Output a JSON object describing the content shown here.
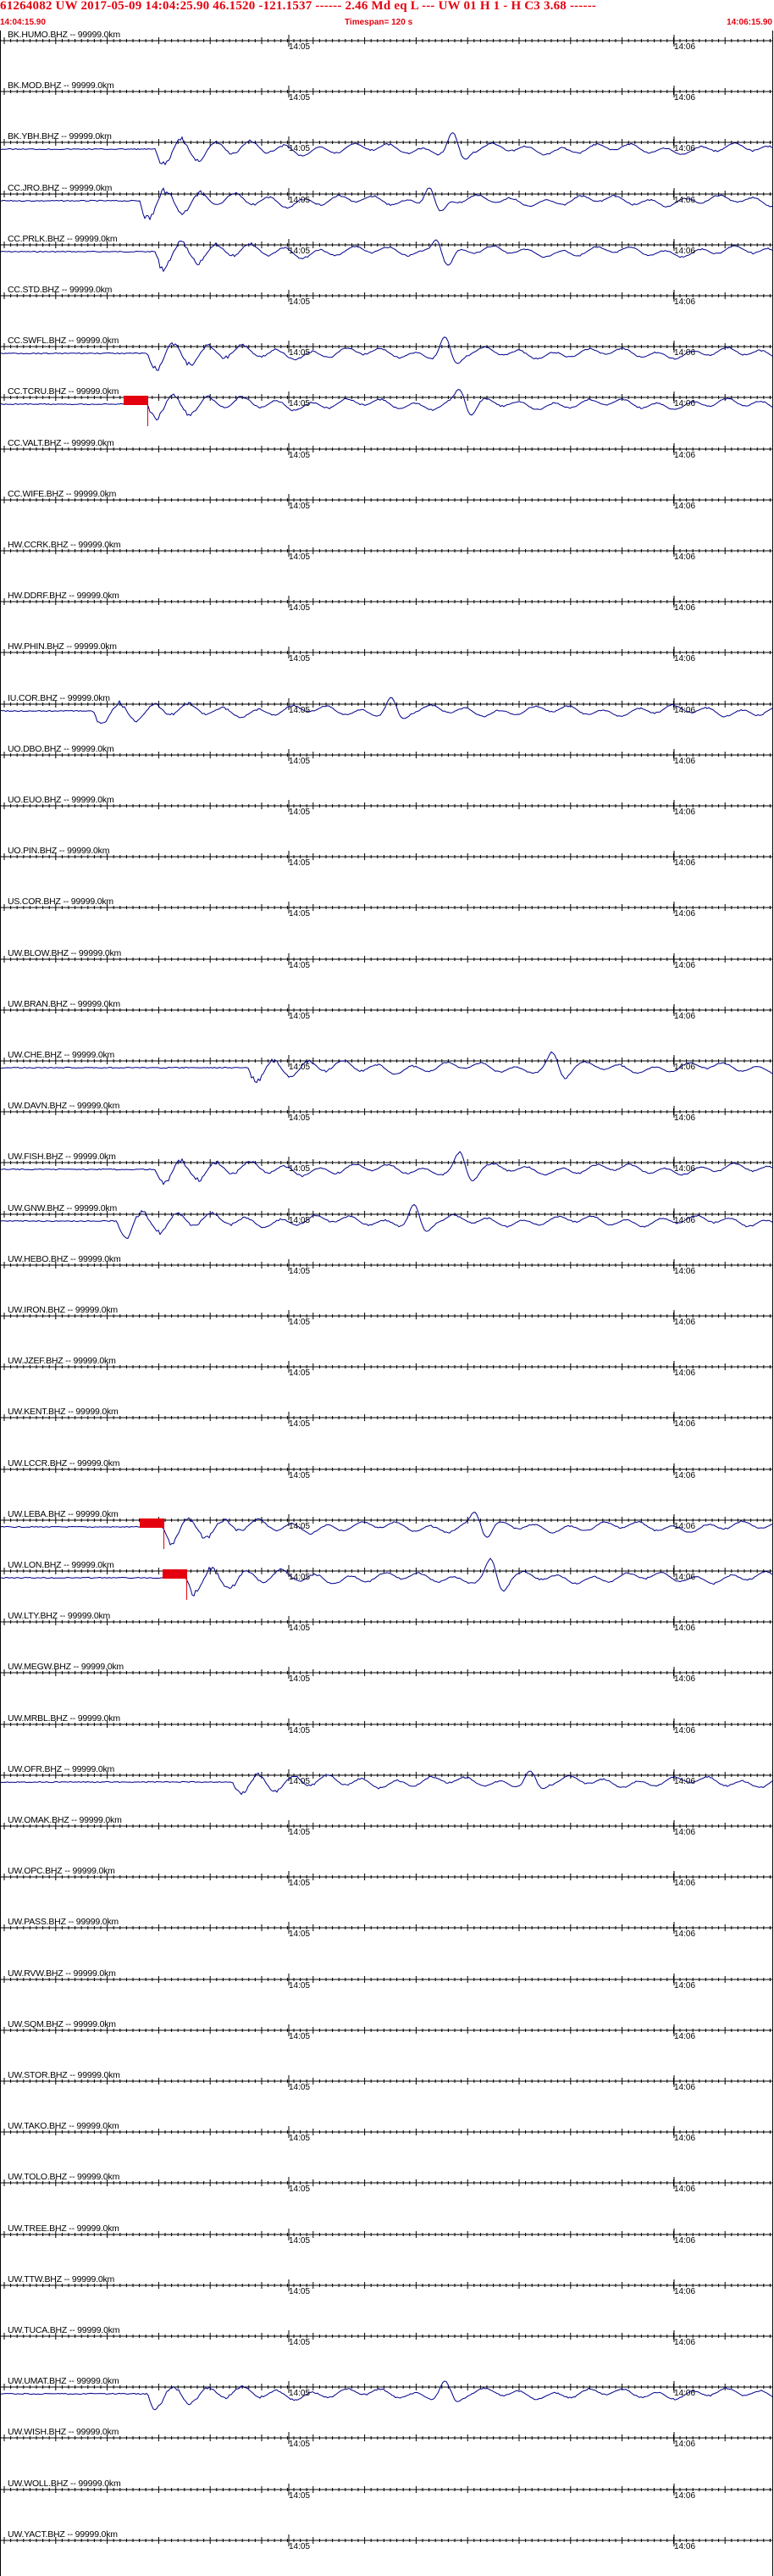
{
  "header": {
    "title": "61264082 UW 2017-05-09 14:04:25.90   46.1520 -121.1537 ------   2.46 Md  eq  L ---     UW 01  H   1  -  H C3    3.68  ------",
    "start_time": "14:04:15.90",
    "timespan": "Timespan= 120 s",
    "end_time": "14:06:15.90"
  },
  "tick_labels": {
    "left": "14:05",
    "right": "14:06"
  },
  "stations": [
    {
      "label": "BK.HUMO.BHZ -- 99999.0km",
      "wave": null
    },
    {
      "label": "BK.MOD.BHZ -- 99999.0km",
      "wave": null
    },
    {
      "label": "BK.YBH.BHZ -- 99999.0km",
      "wave": {
        "onset": 0.2,
        "second": 0.58,
        "amp": 18
      }
    },
    {
      "label": "CC.JRO.BHZ -- 99999.0km",
      "wave": {
        "onset": 0.18,
        "second": 0.55,
        "amp": 20
      }
    },
    {
      "label": "CC.PRLK.BHZ -- 99999.0km",
      "wave": {
        "onset": 0.2,
        "second": 0.56,
        "amp": 18
      }
    },
    {
      "label": "CC.STD.BHZ -- 99999.0km",
      "wave": null
    },
    {
      "label": "CC.SWFL.BHZ -- 99999.0km",
      "wave": {
        "onset": 0.19,
        "second": 0.57,
        "amp": 18
      }
    },
    {
      "label": "CC.TCRU.BHZ -- 99999.0km",
      "wave": {
        "onset": 0.19,
        "second": 0.59,
        "amp": 16
      }
    },
    {
      "label": "CC.VALT.BHZ -- 99999.0km",
      "wave": null
    },
    {
      "label": "CC.WIFE.BHZ -- 99999.0km",
      "wave": null
    },
    {
      "label": "HW.CCRK.BHZ -- 99999.0km",
      "wave": null
    },
    {
      "label": "HW.DDRF.BHZ -- 99999.0km",
      "wave": null
    },
    {
      "label": "HW.PHIN.BHZ -- 99999.0km",
      "wave": null
    },
    {
      "label": "IU.COR.BHZ -- 99999.0km",
      "wave": {
        "onset": 0.12,
        "second": 0.5,
        "amp": 14
      }
    },
    {
      "label": "UO.DBO.BHZ -- 99999.0km",
      "wave": null
    },
    {
      "label": "UO.EUO.BHZ -- 99999.0km",
      "wave": null
    },
    {
      "label": "UO.PIN.BHZ -- 99999.0km",
      "wave": null
    },
    {
      "label": "US.COR.BHZ -- 99999.0km",
      "wave": null
    },
    {
      "label": "UW.BLOW.BHZ -- 99999.0km",
      "wave": null
    },
    {
      "label": "UW.BRAN.BHZ -- 99999.0km",
      "wave": null
    },
    {
      "label": "UW.CHE.BHZ -- 99999.0km",
      "wave": {
        "onset": 0.32,
        "second": 0.71,
        "amp": 14
      }
    },
    {
      "label": "UW.DAVN.BHZ -- 99999.0km",
      "wave": null
    },
    {
      "label": "UW.FISH.BHZ -- 99999.0km",
      "wave": {
        "onset": 0.2,
        "second": 0.59,
        "amp": 16
      }
    },
    {
      "label": "UW.GNW.BHZ -- 99999.0km",
      "wave": {
        "onset": 0.15,
        "second": 0.53,
        "amp": 18
      }
    },
    {
      "label": "UW.HEBO.BHZ -- 99999.0km",
      "wave": null
    },
    {
      "label": "UW.IRON.BHZ -- 99999.0km",
      "wave": null
    },
    {
      "label": "UW.JZEF.BHZ -- 99999.0km",
      "wave": null
    },
    {
      "label": "UW.KENT.BHZ -- 99999.0km",
      "wave": null
    },
    {
      "label": "UW.LCCR.BHZ -- 99999.0km",
      "wave": null
    },
    {
      "label": "UW.LEBA.BHZ -- 99999.0km",
      "wave": {
        "onset": 0.21,
        "second": 0.61,
        "amp": 16
      }
    },
    {
      "label": "UW.LON.BHZ -- 99999.0km",
      "wave": {
        "onset": 0.24,
        "second": 0.63,
        "amp": 18
      }
    },
    {
      "label": "UW.LTY.BHZ -- 99999.0km",
      "wave": null
    },
    {
      "label": "UW.MEGW.BHZ -- 99999.0km",
      "wave": null
    },
    {
      "label": "UW.MRBL.BHZ -- 99999.0km",
      "wave": null
    },
    {
      "label": "UW.OFR.BHZ -- 99999.0km",
      "wave": {
        "onset": 0.3,
        "second": 0.68,
        "amp": 12
      }
    },
    {
      "label": "UW.OMAK.BHZ -- 99999.0km",
      "wave": null
    },
    {
      "label": "UW.OPC.BHZ -- 99999.0km",
      "wave": null
    },
    {
      "label": "UW.PASS.BHZ -- 99999.0km",
      "wave": null
    },
    {
      "label": "UW.RVW.BHZ -- 99999.0km",
      "wave": null
    },
    {
      "label": "UW.SQM.BHZ -- 99999.0km",
      "wave": null
    },
    {
      "label": "UW.STOR.BHZ -- 99999.0km",
      "wave": null
    },
    {
      "label": "UW.TAKO.BHZ -- 99999.0km",
      "wave": null
    },
    {
      "label": "UW.TOLO.BHZ -- 99999.0km",
      "wave": null
    },
    {
      "label": "UW.TREE.BHZ -- 99999.0km",
      "wave": null
    },
    {
      "label": "UW.TTW.BHZ -- 99999.0km",
      "wave": null
    },
    {
      "label": "UW.TUCA.BHZ -- 99999.0km",
      "wave": null
    },
    {
      "label": "UW.UMAT.BHZ -- 99999.0km",
      "wave": {
        "onset": 0.19,
        "second": 0.57,
        "amp": 14
      }
    },
    {
      "label": "UW.WISH.BHZ -- 99999.0km",
      "wave": null
    },
    {
      "label": "UW.WOLL.BHZ -- 99999.0km",
      "wave": null
    },
    {
      "label": "UW.YACT.BHZ -- 99999.0km",
      "wave": null
    }
  ],
  "picks": [
    {
      "station": "CC.TCRU.BHZ"
    },
    {
      "station": "UW.LEBA.BHZ"
    },
    {
      "station": "UW.LON.BHZ"
    }
  ],
  "colors": {
    "header_text": "#e4000f",
    "trace": "#00008b",
    "axis": "#000000",
    "pick": "#e4000f"
  }
}
